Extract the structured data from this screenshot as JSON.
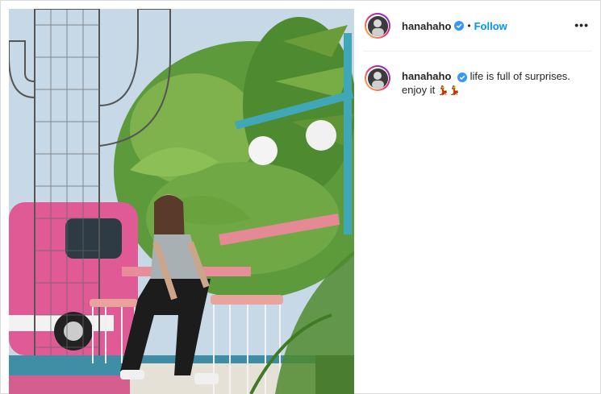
{
  "post": {
    "username": "hanahaho",
    "verified": true,
    "separator": "•",
    "follow_label": "Follow",
    "more_label": "•••",
    "caption": "life is full of surprises. enjoy it",
    "caption_emoji": "💃💃",
    "photo_icon": "photo-image"
  },
  "colors": {
    "follow": "#0095f6",
    "verified": "#3897f0",
    "divider": "#efefef"
  }
}
